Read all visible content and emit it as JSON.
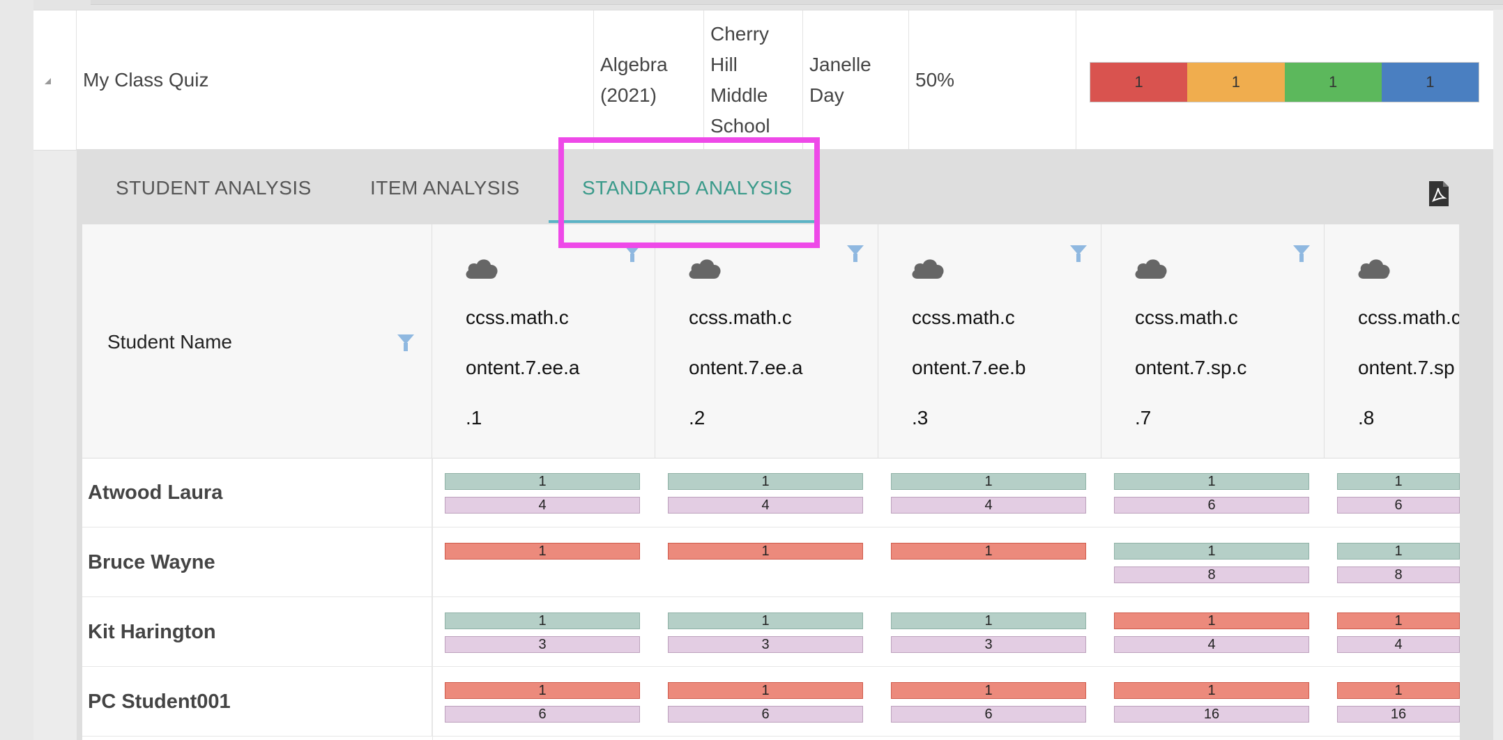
{
  "quiz": {
    "name": "My Class Quiz",
    "subject_line1": "Algebra",
    "subject_line2": "(2021)",
    "school_line1": "Cherry",
    "school_line2": "Hill",
    "school_line3": "Middle",
    "school_line4": "School",
    "teacher_line1": "Janelle",
    "teacher_line2": "Day",
    "score": "50%",
    "distribution": [
      {
        "value": "1",
        "color": "#d9534f"
      },
      {
        "value": "1",
        "color": "#f0ad4e"
      },
      {
        "value": "1",
        "color": "#5cb85c"
      },
      {
        "value": "1",
        "color": "#4a7fc1"
      }
    ]
  },
  "tabs": {
    "student": "STUDENT ANALYSIS",
    "item": "ITEM ANALYSIS",
    "standard": "STANDARD ANALYSIS"
  },
  "table": {
    "name_header": "Student Name",
    "standards": [
      {
        "l1": "ccss.math.c",
        "l2": "ontent.7.ee.a",
        "l3": ".1"
      },
      {
        "l1": "ccss.math.c",
        "l2": "ontent.7.ee.a",
        "l3": ".2"
      },
      {
        "l1": "ccss.math.c",
        "l2": "ontent.7.ee.b",
        "l3": ".3"
      },
      {
        "l1": "ccss.math.c",
        "l2": "ontent.7.sp.c",
        "l3": ".7"
      },
      {
        "l1": "ccss.math.c",
        "l2": "ontent.7.sp",
        "l3": ".8"
      }
    ],
    "rows": [
      {
        "name": "Atwood Laura",
        "cells": [
          {
            "top": "1",
            "top_color": "green",
            "bottom": "4"
          },
          {
            "top": "1",
            "top_color": "green",
            "bottom": "4"
          },
          {
            "top": "1",
            "top_color": "green",
            "bottom": "4"
          },
          {
            "top": "1",
            "top_color": "green",
            "bottom": "6"
          },
          {
            "top": "1",
            "top_color": "green",
            "bottom": "6"
          }
        ]
      },
      {
        "name": "Bruce Wayne",
        "cells": [
          {
            "top": "1",
            "top_color": "red",
            "bottom": ""
          },
          {
            "top": "1",
            "top_color": "red",
            "bottom": ""
          },
          {
            "top": "1",
            "top_color": "red",
            "bottom": ""
          },
          {
            "top": "1",
            "top_color": "green",
            "bottom": "8"
          },
          {
            "top": "1",
            "top_color": "green",
            "bottom": "8"
          }
        ]
      },
      {
        "name": "Kit Harington",
        "cells": [
          {
            "top": "1",
            "top_color": "green",
            "bottom": "3"
          },
          {
            "top": "1",
            "top_color": "green",
            "bottom": "3"
          },
          {
            "top": "1",
            "top_color": "green",
            "bottom": "3"
          },
          {
            "top": "1",
            "top_color": "red",
            "bottom": "4"
          },
          {
            "top": "1",
            "top_color": "red",
            "bottom": "4"
          }
        ]
      },
      {
        "name": "PC Student001",
        "cells": [
          {
            "top": "1",
            "top_color": "red",
            "bottom": "6"
          },
          {
            "top": "1",
            "top_color": "red",
            "bottom": "6"
          },
          {
            "top": "1",
            "top_color": "red",
            "bottom": "6"
          },
          {
            "top": "1",
            "top_color": "red",
            "bottom": "16"
          },
          {
            "top": "1",
            "top_color": "red",
            "bottom": "16"
          }
        ]
      }
    ]
  },
  "colors": {
    "active_tab": "#3a9a8a",
    "highlight": "#ee49e8",
    "filter_icon": "#8fb8e0"
  }
}
